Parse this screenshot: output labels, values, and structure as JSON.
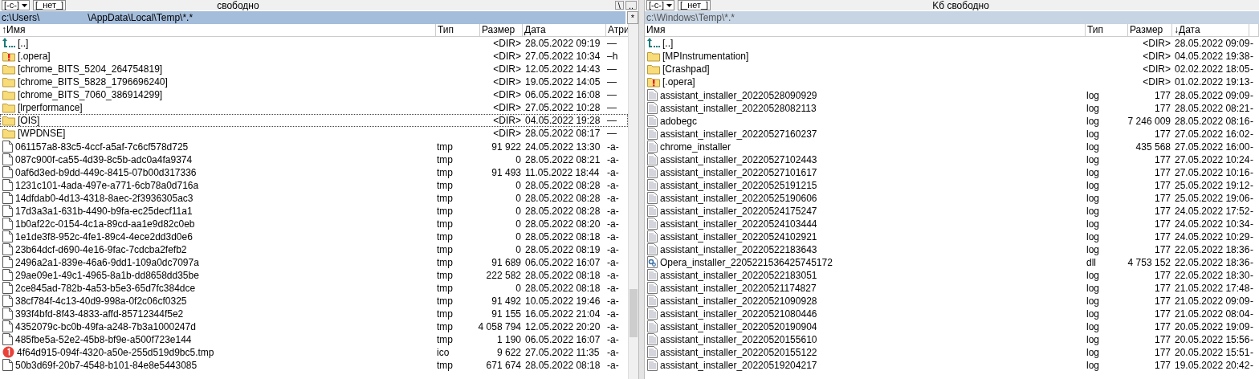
{
  "panels": [
    {
      "active": true,
      "drive": "[-c-]",
      "volume": "[_нет_]",
      "free_space": "свободно",
      "path_start": "c:\\Users\\",
      "path_end": "\\AppData\\Local\\Temp\\*.*",
      "buttons": [
        "\\",
        ".."
      ],
      "path_button": "*",
      "columns": [
        "↑Имя",
        "Тип",
        "Размер",
        "Дата",
        "Атри"
      ],
      "rows": [
        {
          "kind": "up",
          "name": "[..]",
          "size": "<DIR>",
          "date": "28.05.2022 09:19",
          "attr": "—",
          "focused": false
        },
        {
          "kind": "folder-warning",
          "name": "[.opera]",
          "size": "<DIR>",
          "date": "27.05.2022 10:34",
          "attr": "–h",
          "focused": false
        },
        {
          "kind": "folder",
          "name": "[chrome_BITS_5204_264754819]",
          "size": "<DIR>",
          "date": "12.05.2022 14:43",
          "attr": "—",
          "focused": false
        },
        {
          "kind": "folder",
          "name": "[chrome_BITS_5828_1796696240]",
          "size": "<DIR>",
          "date": "19.05.2022 14:05",
          "attr": "—",
          "focused": false
        },
        {
          "kind": "folder",
          "name": "[chrome_BITS_7060_386914299]",
          "size": "<DIR>",
          "date": "06.05.2022 16:08",
          "attr": "—",
          "focused": false
        },
        {
          "kind": "folder",
          "name": "[lrperformance]",
          "size": "<DIR>",
          "date": "27.05.2022 10:28",
          "attr": "—",
          "focused": false
        },
        {
          "kind": "folder",
          "name": "[OIS]",
          "size": "<DIR>",
          "date": "04.05.2022 19:28",
          "attr": "—",
          "focused": true
        },
        {
          "kind": "folder",
          "name": "[WPDNSE]",
          "size": "<DIR>",
          "date": "28.05.2022 08:17",
          "attr": "—",
          "focused": false
        },
        {
          "kind": "file",
          "name": "061157a8-83c5-4ccf-a5af-7c6cf578d725",
          "type": "tmp",
          "size": "91 922",
          "date": "24.05.2022 13:30",
          "attr": "-a-",
          "focused": false
        },
        {
          "kind": "file",
          "name": "087c900f-ca55-4d39-8c5b-adc0a4fa9374",
          "type": "tmp",
          "size": "0",
          "date": "28.05.2022 08:21",
          "attr": "-a-",
          "focused": false
        },
        {
          "kind": "file",
          "name": "0af6d3ed-b9dd-449c-8415-07b00d317336",
          "type": "tmp",
          "size": "91 493",
          "date": "11.05.2022 18:44",
          "attr": "-a-",
          "focused": false
        },
        {
          "kind": "file",
          "name": "1231c101-4ada-497e-a771-6cb78a0d716a",
          "type": "tmp",
          "size": "0",
          "date": "28.05.2022 08:28",
          "attr": "-a-",
          "focused": false
        },
        {
          "kind": "file",
          "name": "14dfdab0-4d13-4318-8aec-2f3936305ac3",
          "type": "tmp",
          "size": "0",
          "date": "28.05.2022 08:28",
          "attr": "-a-",
          "focused": false
        },
        {
          "kind": "file",
          "name": "17d3a3a1-631b-4490-b9fa-ec25decf11a1",
          "type": "tmp",
          "size": "0",
          "date": "28.05.2022 08:28",
          "attr": "-a-",
          "focused": false
        },
        {
          "kind": "file",
          "name": "1b0af22c-0154-4c1a-89cd-aa1e9d82c0eb",
          "type": "tmp",
          "size": "0",
          "date": "28.05.2022 08:20",
          "attr": "-a-",
          "focused": false
        },
        {
          "kind": "file",
          "name": "1e1de3f8-952c-4fe1-89c4-4ece2dd3d0e6",
          "type": "tmp",
          "size": "0",
          "date": "28.05.2022 08:18",
          "attr": "-a-",
          "focused": false
        },
        {
          "kind": "file",
          "name": "23b64dcf-d690-4e16-9fac-7cdcba2fefb2",
          "type": "tmp",
          "size": "0",
          "date": "28.05.2022 08:19",
          "attr": "-a-",
          "focused": false
        },
        {
          "kind": "file",
          "name": "2496a2a1-839e-46a6-9dd1-109a0dc7097a",
          "type": "tmp",
          "size": "91 689",
          "date": "06.05.2022 16:07",
          "attr": "-a-",
          "focused": false
        },
        {
          "kind": "file",
          "name": "29ae09e1-49c1-4965-8a1b-dd8658dd35be",
          "type": "tmp",
          "size": "222 582",
          "date": "28.05.2022 08:18",
          "attr": "-a-",
          "focused": false
        },
        {
          "kind": "file",
          "name": "2ce845ad-782b-4a53-b5e3-65d7fc384dce",
          "type": "tmp",
          "size": "0",
          "date": "28.05.2022 08:18",
          "attr": "-a-",
          "focused": false
        },
        {
          "kind": "file",
          "name": "38cf784f-4c13-40d9-998a-0f2c06cf0325",
          "type": "tmp",
          "size": "91 492",
          "date": "10.05.2022 19:46",
          "attr": "-a-",
          "focused": false
        },
        {
          "kind": "file",
          "name": "393f4bfd-8f43-4833-affd-85712344f5e2",
          "type": "tmp",
          "size": "91 155",
          "date": "16.05.2022 21:04",
          "attr": "-a-",
          "focused": false
        },
        {
          "kind": "file",
          "name": "4352079c-bc0b-49fa-a248-7b3a1000247d",
          "type": "tmp",
          "size": "4 058 794",
          "date": "12.05.2022 20:20",
          "attr": "-a-",
          "focused": false
        },
        {
          "kind": "file",
          "name": "485fbe5a-52e2-45b8-bf9e-a500f723e144",
          "type": "tmp",
          "size": "1 190",
          "date": "06.05.2022 16:07",
          "attr": "-a-",
          "focused": false
        },
        {
          "kind": "ico",
          "name": "4f64d915-094f-4320-a50e-255d519d9bc5.tmp",
          "type": "ico",
          "size": "9 622",
          "date": "27.05.2022 11:35",
          "attr": "-a-",
          "focused": false
        },
        {
          "kind": "file",
          "name": "50b3d69f-20b7-4548-b101-84e8e5443085",
          "type": "tmp",
          "size": "671 674",
          "date": "28.05.2022 08:18",
          "attr": "-a-",
          "focused": false
        }
      ]
    },
    {
      "active": false,
      "drive": "[-c-]",
      "volume": "[_нет_]",
      "free_space": "Kб свободно",
      "path_start": "c:\\Windows\\Temp\\*.*",
      "columns": [
        "Имя",
        "Тип",
        "Размер",
        "↓Дата"
      ],
      "rows": [
        {
          "kind": "up",
          "name": "[..]",
          "size": "<DIR>",
          "date": "28.05.2022 09:09",
          "attr": "-",
          "focused": false
        },
        {
          "kind": "folder",
          "name": "[MPInstrumentation]",
          "size": "<DIR>",
          "date": "04.05.2022 19:38",
          "attr": "-",
          "focused": false
        },
        {
          "kind": "folder",
          "name": "[Crashpad]",
          "size": "<DIR>",
          "date": "02.02.2022 18:05",
          "attr": "-",
          "focused": false
        },
        {
          "kind": "folder-warning",
          "name": "[.opera]",
          "size": "<DIR>",
          "date": "01.02.2022 19:13",
          "attr": "-",
          "focused": false
        },
        {
          "kind": "log",
          "name": "assistant_installer_20220528090929",
          "type": "log",
          "size": "177",
          "date": "28.05.2022 09:09",
          "attr": "-",
          "focused": false
        },
        {
          "kind": "log",
          "name": "assistant_installer_20220528082113",
          "type": "log",
          "size": "177",
          "date": "28.05.2022 08:21",
          "attr": "-",
          "focused": false
        },
        {
          "kind": "log",
          "name": "adobegc",
          "type": "log",
          "size": "7 246 009",
          "date": "28.05.2022 08:16",
          "attr": "-",
          "focused": false
        },
        {
          "kind": "log",
          "name": "assistant_installer_20220527160237",
          "type": "log",
          "size": "177",
          "date": "27.05.2022 16:02",
          "attr": "-",
          "focused": false
        },
        {
          "kind": "log",
          "name": "chrome_installer",
          "type": "log",
          "size": "435 568",
          "date": "27.05.2022 16:00",
          "attr": "-",
          "focused": false
        },
        {
          "kind": "log",
          "name": "assistant_installer_20220527102443",
          "type": "log",
          "size": "177",
          "date": "27.05.2022 10:24",
          "attr": "-",
          "focused": false
        },
        {
          "kind": "log",
          "name": "assistant_installer_20220527101617",
          "type": "log",
          "size": "177",
          "date": "27.05.2022 10:16",
          "attr": "-",
          "focused": false
        },
        {
          "kind": "log",
          "name": "assistant_installer_20220525191215",
          "type": "log",
          "size": "177",
          "date": "25.05.2022 19:12",
          "attr": "-",
          "focused": false
        },
        {
          "kind": "log",
          "name": "assistant_installer_20220525190606",
          "type": "log",
          "size": "177",
          "date": "25.05.2022 19:06",
          "attr": "-",
          "focused": false
        },
        {
          "kind": "log",
          "name": "assistant_installer_20220524175247",
          "type": "log",
          "size": "177",
          "date": "24.05.2022 17:52",
          "attr": "-",
          "focused": false
        },
        {
          "kind": "log",
          "name": "assistant_installer_20220524103444",
          "type": "log",
          "size": "177",
          "date": "24.05.2022 10:34",
          "attr": "-",
          "focused": false
        },
        {
          "kind": "log",
          "name": "assistant_installer_20220524102921",
          "type": "log",
          "size": "177",
          "date": "24.05.2022 10:29",
          "attr": "-",
          "focused": false
        },
        {
          "kind": "log",
          "name": "assistant_installer_20220522183643",
          "type": "log",
          "size": "177",
          "date": "22.05.2022 18:36",
          "attr": "-",
          "focused": false
        },
        {
          "kind": "dll",
          "name": "Opera_installer_2205221536425745172",
          "type": "dll",
          "size": "4 753 152",
          "date": "22.05.2022 18:36",
          "attr": "-",
          "focused": false
        },
        {
          "kind": "log",
          "name": "assistant_installer_20220522183051",
          "type": "log",
          "size": "177",
          "date": "22.05.2022 18:30",
          "attr": "-",
          "focused": false
        },
        {
          "kind": "log",
          "name": "assistant_installer_20220521174827",
          "type": "log",
          "size": "177",
          "date": "21.05.2022 17:48",
          "attr": "-",
          "focused": false
        },
        {
          "kind": "log",
          "name": "assistant_installer_20220521090928",
          "type": "log",
          "size": "177",
          "date": "21.05.2022 09:09",
          "attr": "-",
          "focused": false
        },
        {
          "kind": "log",
          "name": "assistant_installer_20220521080446",
          "type": "log",
          "size": "177",
          "date": "21.05.2022 08:04",
          "attr": "-",
          "focused": false
        },
        {
          "kind": "log",
          "name": "assistant_installer_20220520190904",
          "type": "log",
          "size": "177",
          "date": "20.05.2022 19:09",
          "attr": "-",
          "focused": false
        },
        {
          "kind": "log",
          "name": "assistant_installer_20220520155610",
          "type": "log",
          "size": "177",
          "date": "20.05.2022 15:56",
          "attr": "-",
          "focused": false
        },
        {
          "kind": "log",
          "name": "assistant_installer_20220520155122",
          "type": "log",
          "size": "177",
          "date": "20.05.2022 15:51",
          "attr": "-",
          "focused": false
        },
        {
          "kind": "log",
          "name": "assistant_installer_20220519204217",
          "type": "log",
          "size": "177",
          "date": "19.05.2022 20:42",
          "attr": "-",
          "focused": false
        }
      ]
    }
  ]
}
